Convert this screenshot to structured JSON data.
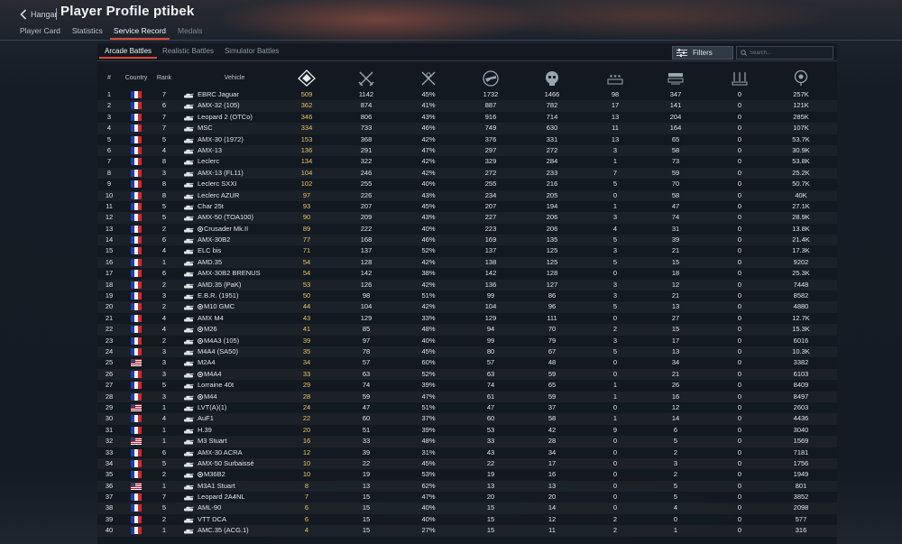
{
  "header": {
    "back_label": "Hangar",
    "title": "Player Profile ptibek",
    "tabs": [
      {
        "label": "Player Card"
      },
      {
        "label": "Statistics"
      },
      {
        "label": "Service Record"
      },
      {
        "label": "Medals"
      }
    ],
    "active_tab": "Service Record"
  },
  "modes": {
    "items": [
      {
        "label": "Arcade Battles"
      },
      {
        "label": "Realistic Battles"
      },
      {
        "label": "Simulator Battles"
      }
    ],
    "active": "Arcade Battles"
  },
  "toolbar": {
    "filters_label": "Filters",
    "search_placeholder": "Search..."
  },
  "table": {
    "headers": {
      "num": "#",
      "country": "Country",
      "rank": "Rank",
      "vehicle": "Vehicle"
    },
    "stat_icons": [
      "score-icon",
      "battles-icon",
      "victories-icon",
      "air-kills-icon",
      "ground-kills-icon",
      "naval-kills-icon",
      "respawns-icon",
      "sp-icon",
      "lions-icon"
    ],
    "accent_color": "#e8c468",
    "rows": [
      {
        "n": "1",
        "country": "fr",
        "rank": "7",
        "type": "tank",
        "prefix": false,
        "name": "EBRC Jaguar",
        "score": "509",
        "v1": "1142",
        "v2": "45%",
        "v3": "1732",
        "v4": "1466",
        "v5": "98",
        "v6": "347",
        "v7": "0",
        "v8": "257K"
      },
      {
        "n": "2",
        "country": "fr",
        "rank": "6",
        "type": "tank",
        "prefix": false,
        "name": "AMX-32 (105)",
        "score": "362",
        "v1": "874",
        "v2": "41%",
        "v3": "887",
        "v4": "782",
        "v5": "17",
        "v6": "141",
        "v7": "0",
        "v8": "121K"
      },
      {
        "n": "3",
        "country": "fr",
        "rank": "7",
        "type": "tank",
        "prefix": false,
        "name": "Leopard 2 (OTCo)",
        "score": "346",
        "v1": "806",
        "v2": "43%",
        "v3": "916",
        "v4": "714",
        "v5": "13",
        "v6": "204",
        "v7": "0",
        "v8": "285K"
      },
      {
        "n": "4",
        "country": "fr",
        "rank": "7",
        "type": "tank",
        "prefix": false,
        "name": "MSC",
        "score": "334",
        "v1": "733",
        "v2": "46%",
        "v3": "749",
        "v4": "630",
        "v5": "11",
        "v6": "164",
        "v7": "0",
        "v8": "107K"
      },
      {
        "n": "5",
        "country": "fr",
        "rank": "5",
        "type": "tank",
        "prefix": false,
        "name": "AMX-30 (1972)",
        "score": "153",
        "v1": "368",
        "v2": "42%",
        "v3": "376",
        "v4": "331",
        "v5": "13",
        "v6": "65",
        "v7": "0",
        "v8": "53.7K"
      },
      {
        "n": "6",
        "country": "fr",
        "rank": "4",
        "type": "tank",
        "prefix": false,
        "name": "AMX-13",
        "score": "136",
        "v1": "291",
        "v2": "47%",
        "v3": "297",
        "v4": "272",
        "v5": "3",
        "v6": "58",
        "v7": "0",
        "v8": "30.9K"
      },
      {
        "n": "7",
        "country": "fr",
        "rank": "8",
        "type": "tank",
        "prefix": false,
        "name": "Leclerc",
        "score": "134",
        "v1": "322",
        "v2": "42%",
        "v3": "329",
        "v4": "284",
        "v5": "1",
        "v6": "73",
        "v7": "0",
        "v8": "53.8K"
      },
      {
        "n": "8",
        "country": "fr",
        "rank": "3",
        "type": "tank",
        "prefix": false,
        "name": "AMX-13 (FL11)",
        "score": "104",
        "v1": "246",
        "v2": "42%",
        "v3": "272",
        "v4": "233",
        "v5": "7",
        "v6": "59",
        "v7": "0",
        "v8": "25.2K"
      },
      {
        "n": "9",
        "country": "fr",
        "rank": "8",
        "type": "tank",
        "prefix": false,
        "name": "Leclerc SXXI",
        "score": "102",
        "v1": "255",
        "v2": "40%",
        "v3": "255",
        "v4": "216",
        "v5": "5",
        "v6": "70",
        "v7": "0",
        "v8": "50.7K"
      },
      {
        "n": "10",
        "country": "fr",
        "rank": "8",
        "type": "tank",
        "prefix": false,
        "name": "Leclerc AZUR",
        "score": "97",
        "v1": "226",
        "v2": "43%",
        "v3": "234",
        "v4": "205",
        "v5": "0",
        "v6": "58",
        "v7": "0",
        "v8": "40K"
      },
      {
        "n": "11",
        "country": "fr",
        "rank": "5",
        "type": "tank",
        "prefix": false,
        "name": "Char 25t",
        "score": "93",
        "v1": "207",
        "v2": "45%",
        "v3": "207",
        "v4": "194",
        "v5": "1",
        "v6": "47",
        "v7": "0",
        "v8": "27.1K"
      },
      {
        "n": "12",
        "country": "fr",
        "rank": "5",
        "type": "tank",
        "prefix": false,
        "name": "AMX-50 (TOA100)",
        "score": "90",
        "v1": "209",
        "v2": "43%",
        "v3": "227",
        "v4": "206",
        "v5": "3",
        "v6": "74",
        "v7": "0",
        "v8": "28.9K"
      },
      {
        "n": "13",
        "country": "fr",
        "rank": "2",
        "type": "tank",
        "prefix": true,
        "name": "Crusader Mk.II",
        "score": "89",
        "v1": "222",
        "v2": "40%",
        "v3": "223",
        "v4": "206",
        "v5": "4",
        "v6": "31",
        "v7": "0",
        "v8": "13.8K"
      },
      {
        "n": "14",
        "country": "fr",
        "rank": "6",
        "type": "tank",
        "prefix": false,
        "name": "AMX-30B2",
        "score": "77",
        "v1": "168",
        "v2": "46%",
        "v3": "169",
        "v4": "135",
        "v5": "5",
        "v6": "39",
        "v7": "0",
        "v8": "21.4K"
      },
      {
        "n": "15",
        "country": "fr",
        "rank": "4",
        "type": "tank",
        "prefix": false,
        "name": "ELC bis",
        "score": "71",
        "v1": "137",
        "v2": "52%",
        "v3": "137",
        "v4": "125",
        "v5": "3",
        "v6": "21",
        "v7": "0",
        "v8": "17.3K"
      },
      {
        "n": "16",
        "country": "fr",
        "rank": "1",
        "type": "tank",
        "prefix": false,
        "name": "AMD.35",
        "score": "54",
        "v1": "128",
        "v2": "42%",
        "v3": "138",
        "v4": "125",
        "v5": "5",
        "v6": "15",
        "v7": "0",
        "v8": "9202"
      },
      {
        "n": "17",
        "country": "fr",
        "rank": "6",
        "type": "tank",
        "prefix": false,
        "name": "AMX-30B2 BRENUS",
        "score": "54",
        "v1": "142",
        "v2": "38%",
        "v3": "142",
        "v4": "128",
        "v5": "0",
        "v6": "18",
        "v7": "0",
        "v8": "25.3K"
      },
      {
        "n": "18",
        "country": "fr",
        "rank": "2",
        "type": "tank",
        "prefix": false,
        "name": "AMD.35 (PaK)",
        "score": "53",
        "v1": "126",
        "v2": "42%",
        "v3": "136",
        "v4": "127",
        "v5": "3",
        "v6": "12",
        "v7": "0",
        "v8": "7448"
      },
      {
        "n": "19",
        "country": "fr",
        "rank": "3",
        "type": "tank",
        "prefix": false,
        "name": "E.B.R. (1951)",
        "score": "50",
        "v1": "98",
        "v2": "51%",
        "v3": "99",
        "v4": "86",
        "v5": "3",
        "v6": "21",
        "v7": "0",
        "v8": "8582"
      },
      {
        "n": "20",
        "country": "fr",
        "rank": "2",
        "type": "tank",
        "prefix": true,
        "name": "M10 GMC",
        "score": "44",
        "v1": "104",
        "v2": "42%",
        "v3": "104",
        "v4": "96",
        "v5": "5",
        "v6": "13",
        "v7": "0",
        "v8": "4880"
      },
      {
        "n": "21",
        "country": "fr",
        "rank": "4",
        "type": "tank",
        "prefix": false,
        "name": "AMX M4",
        "score": "43",
        "v1": "129",
        "v2": "33%",
        "v3": "129",
        "v4": "111",
        "v5": "0",
        "v6": "27",
        "v7": "0",
        "v8": "12.7K"
      },
      {
        "n": "22",
        "country": "fr",
        "rank": "4",
        "type": "tank",
        "prefix": true,
        "name": "M26",
        "score": "41",
        "v1": "85",
        "v2": "48%",
        "v3": "94",
        "v4": "70",
        "v5": "2",
        "v6": "15",
        "v7": "0",
        "v8": "15.3K"
      },
      {
        "n": "23",
        "country": "fr",
        "rank": "2",
        "type": "tank",
        "prefix": true,
        "name": "M4A3 (105)",
        "score": "39",
        "v1": "97",
        "v2": "40%",
        "v3": "99",
        "v4": "79",
        "v5": "3",
        "v6": "17",
        "v7": "0",
        "v8": "6016"
      },
      {
        "n": "24",
        "country": "fr",
        "rank": "3",
        "type": "tank",
        "prefix": false,
        "name": "M4A4 (SA50)",
        "score": "35",
        "v1": "78",
        "v2": "45%",
        "v3": "80",
        "v4": "67",
        "v5": "5",
        "v6": "13",
        "v7": "0",
        "v8": "10.3K"
      },
      {
        "n": "25",
        "country": "us",
        "rank": "3",
        "type": "tank",
        "prefix": false,
        "name": "M2A4",
        "score": "34",
        "v1": "57",
        "v2": "60%",
        "v3": "57",
        "v4": "48",
        "v5": "0",
        "v6": "34",
        "v7": "0",
        "v8": "3382"
      },
      {
        "n": "26",
        "country": "fr",
        "rank": "3",
        "type": "tank",
        "prefix": true,
        "name": "M4A4",
        "score": "33",
        "v1": "63",
        "v2": "52%",
        "v3": "63",
        "v4": "59",
        "v5": "0",
        "v6": "21",
        "v7": "0",
        "v8": "6103"
      },
      {
        "n": "27",
        "country": "fr",
        "rank": "5",
        "type": "tank",
        "prefix": false,
        "name": "Lorraine 40t",
        "score": "29",
        "v1": "74",
        "v2": "39%",
        "v3": "74",
        "v4": "65",
        "v5": "1",
        "v6": "26",
        "v7": "0",
        "v8": "8409"
      },
      {
        "n": "28",
        "country": "fr",
        "rank": "3",
        "type": "tank",
        "prefix": true,
        "name": "M44",
        "score": "28",
        "v1": "59",
        "v2": "47%",
        "v3": "61",
        "v4": "59",
        "v5": "1",
        "v6": "16",
        "v7": "0",
        "v8": "8497"
      },
      {
        "n": "29",
        "country": "us",
        "rank": "1",
        "type": "tank",
        "prefix": false,
        "name": "LVT(A)(1)",
        "score": "24",
        "v1": "47",
        "v2": "51%",
        "v3": "47",
        "v4": "37",
        "v5": "0",
        "v6": "12",
        "v7": "0",
        "v8": "2603"
      },
      {
        "n": "30",
        "country": "fr",
        "rank": "4",
        "type": "tank",
        "prefix": false,
        "name": "AuF1",
        "score": "22",
        "v1": "60",
        "v2": "37%",
        "v3": "60",
        "v4": "58",
        "v5": "1",
        "v6": "14",
        "v7": "0",
        "v8": "4436"
      },
      {
        "n": "31",
        "country": "fr",
        "rank": "1",
        "type": "tank",
        "prefix": false,
        "name": "H.39",
        "score": "20",
        "v1": "51",
        "v2": "39%",
        "v3": "53",
        "v4": "42",
        "v5": "9",
        "v6": "6",
        "v7": "0",
        "v8": "3040"
      },
      {
        "n": "32",
        "country": "us",
        "rank": "1",
        "type": "tank",
        "prefix": false,
        "name": "M3 Stuart",
        "score": "16",
        "v1": "33",
        "v2": "48%",
        "v3": "33",
        "v4": "28",
        "v5": "0",
        "v6": "5",
        "v7": "0",
        "v8": "1569"
      },
      {
        "n": "33",
        "country": "fr",
        "rank": "6",
        "type": "tank",
        "prefix": false,
        "name": "AMX-30 ACRA",
        "score": "12",
        "v1": "39",
        "v2": "31%",
        "v3": "43",
        "v4": "34",
        "v5": "0",
        "v6": "2",
        "v7": "0",
        "v8": "7181"
      },
      {
        "n": "34",
        "country": "fr",
        "rank": "5",
        "type": "tank",
        "prefix": false,
        "name": "AMX-50 Surbaissé",
        "score": "10",
        "v1": "22",
        "v2": "45%",
        "v3": "22",
        "v4": "17",
        "v5": "0",
        "v6": "3",
        "v7": "0",
        "v8": "1756"
      },
      {
        "n": "35",
        "country": "fr",
        "rank": "2",
        "type": "tank",
        "prefix": true,
        "name": "M36B2",
        "score": "10",
        "v1": "19",
        "v2": "53%",
        "v3": "19",
        "v4": "16",
        "v5": "0",
        "v6": "2",
        "v7": "0",
        "v8": "1949"
      },
      {
        "n": "36",
        "country": "us",
        "rank": "1",
        "type": "tank",
        "prefix": false,
        "name": "M3A1 Stuart",
        "score": "8",
        "v1": "13",
        "v2": "62%",
        "v3": "13",
        "v4": "13",
        "v5": "0",
        "v6": "5",
        "v7": "0",
        "v8": "801"
      },
      {
        "n": "37",
        "country": "fr",
        "rank": "7",
        "type": "tank",
        "prefix": false,
        "name": "Leopard 2A4NL",
        "score": "7",
        "v1": "15",
        "v2": "47%",
        "v3": "20",
        "v4": "20",
        "v5": "0",
        "v6": "5",
        "v7": "0",
        "v8": "3852"
      },
      {
        "n": "38",
        "country": "fr",
        "rank": "5",
        "type": "tank",
        "prefix": false,
        "name": "AML-90",
        "score": "6",
        "v1": "15",
        "v2": "40%",
        "v3": "15",
        "v4": "14",
        "v5": "0",
        "v6": "4",
        "v7": "0",
        "v8": "2098"
      },
      {
        "n": "39",
        "country": "fr",
        "rank": "2",
        "type": "tank",
        "prefix": false,
        "name": "VTT DCA",
        "score": "6",
        "v1": "15",
        "v2": "40%",
        "v3": "15",
        "v4": "12",
        "v5": "2",
        "v6": "0",
        "v7": "0",
        "v8": "577"
      },
      {
        "n": "40",
        "country": "fr",
        "rank": "1",
        "type": "tank",
        "prefix": false,
        "name": "AMC.35 (ACG.1)",
        "score": "4",
        "v1": "15",
        "v2": "27%",
        "v3": "15",
        "v4": "11",
        "v5": "2",
        "v6": "1",
        "v7": "0",
        "v8": "316"
      }
    ]
  }
}
